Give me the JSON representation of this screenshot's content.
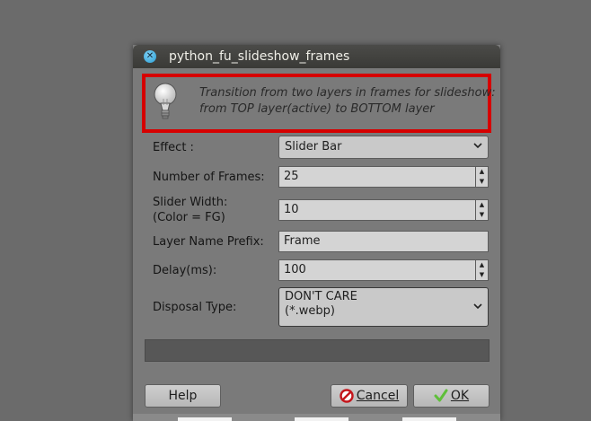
{
  "window": {
    "title": "python_fu_slideshow_frames"
  },
  "info": {
    "line1": "Transition from two layers in frames for slideshow:",
    "line2": "from TOP layer(active) to BOTTOM layer"
  },
  "form": {
    "effect": {
      "label": "Effect :",
      "value": "Slider Bar"
    },
    "frames": {
      "label": "Number of Frames:",
      "value": "25"
    },
    "slider_width": {
      "label1": "Slider Width:",
      "label2": "(Color = FG)",
      "value": "10"
    },
    "prefix": {
      "label": "Layer Name Prefix:",
      "value": "Frame"
    },
    "delay": {
      "label": "Delay(ms):",
      "value": "100"
    },
    "disposal": {
      "label": "Disposal Type:",
      "value1": "DON'T CARE",
      "value2": "(*.webp)"
    }
  },
  "buttons": {
    "help": "Help",
    "cancel": "Cancel",
    "ok": "OK"
  },
  "colors": {
    "highlight": "#d60000",
    "ok_check": "#5fbf3a",
    "cancel_icon": "#c4161c"
  }
}
